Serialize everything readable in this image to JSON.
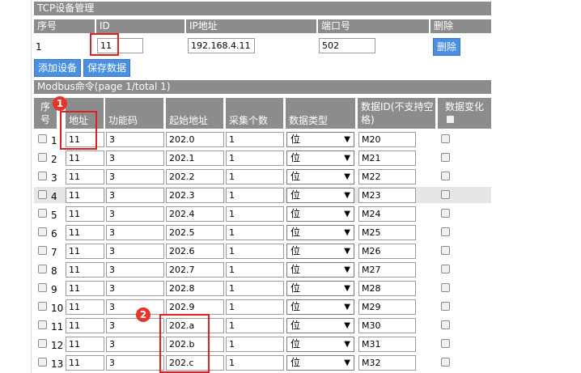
{
  "tcp": {
    "title": "TCP设备管理",
    "headers": [
      "序号",
      "ID",
      "IP地址",
      "端口号",
      "删除"
    ],
    "row": {
      "index": "1",
      "id": "11",
      "ip": "192.168.4.11",
      "port": "502",
      "delete_label": "删除"
    }
  },
  "buttons": {
    "add_device": "添加设备",
    "save_data": "保存数据"
  },
  "modbus": {
    "title": "Modbus命令(page 1/total 1)",
    "headers": {
      "index": "序号",
      "address": "地址",
      "func": "功能码",
      "start": "起始地址",
      "count": "采集个数",
      "dtype": "数据类型",
      "dataid": "数据ID(不支持空格)",
      "change": "数据变化"
    },
    "rows": [
      {
        "n": "1",
        "addr": "11",
        "func": "3",
        "start": "202.0",
        "count": "1",
        "type": "位",
        "id": "M20"
      },
      {
        "n": "2",
        "addr": "11",
        "func": "3",
        "start": "202.1",
        "count": "1",
        "type": "位",
        "id": "M21"
      },
      {
        "n": "3",
        "addr": "11",
        "func": "3",
        "start": "202.2",
        "count": "1",
        "type": "位",
        "id": "M22"
      },
      {
        "n": "4",
        "addr": "11",
        "func": "3",
        "start": "202.3",
        "count": "1",
        "type": "位",
        "id": "M23"
      },
      {
        "n": "5",
        "addr": "11",
        "func": "3",
        "start": "202.4",
        "count": "1",
        "type": "位",
        "id": "M24"
      },
      {
        "n": "6",
        "addr": "11",
        "func": "3",
        "start": "202.5",
        "count": "1",
        "type": "位",
        "id": "M25"
      },
      {
        "n": "7",
        "addr": "11",
        "func": "3",
        "start": "202.6",
        "count": "1",
        "type": "位",
        "id": "M26"
      },
      {
        "n": "8",
        "addr": "11",
        "func": "3",
        "start": "202.7",
        "count": "1",
        "type": "位",
        "id": "M27"
      },
      {
        "n": "9",
        "addr": "11",
        "func": "3",
        "start": "202.8",
        "count": "1",
        "type": "位",
        "id": "M28"
      },
      {
        "n": "10",
        "addr": "11",
        "func": "3",
        "start": "202.9",
        "count": "1",
        "type": "位",
        "id": "M29"
      },
      {
        "n": "11",
        "addr": "11",
        "func": "3",
        "start": "202.a",
        "count": "1",
        "type": "位",
        "id": "M30"
      },
      {
        "n": "12",
        "addr": "11",
        "func": "3",
        "start": "202.b",
        "count": "1",
        "type": "位",
        "id": "M31"
      },
      {
        "n": "13",
        "addr": "11",
        "func": "3",
        "start": "202.c",
        "count": "1",
        "type": "位",
        "id": "M32"
      }
    ]
  },
  "annotations": {
    "badge1": "1",
    "badge2": "2"
  },
  "colors": {
    "header_bg": "#8c8c8c",
    "button_bg": "#4a90e2",
    "highlight": "#e02020",
    "badge": "#e8332a"
  }
}
